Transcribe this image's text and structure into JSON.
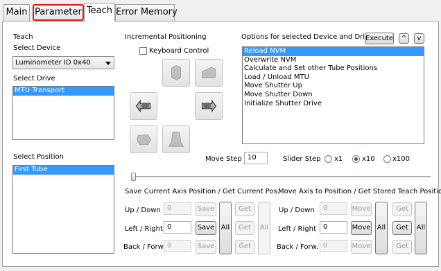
{
  "tabs": [
    {
      "label": "Main"
    },
    {
      "label": "Parameter"
    },
    {
      "label": "Teach"
    },
    {
      "label": "Error Memory"
    }
  ],
  "teach": {
    "title": "Teach",
    "select_device_label": "Select Device",
    "device_value": "Luminometer ID 0x40",
    "select_drive_label": "Select Drive",
    "drives": [
      "MTU Transport"
    ],
    "select_position_label": "Select Position",
    "positions": [
      "First Tube"
    ]
  },
  "incremental": {
    "title": "Incremental Positioning",
    "keyboard_control": "Keyboard Control",
    "keyboard_checked": false
  },
  "options": {
    "title": "Options for selected Device and Drive",
    "execute": "Execute",
    "up": "^",
    "down": "v",
    "items": [
      "Reload NVM",
      "Overwrite NVM",
      "Calculate and Set other Tube Positions",
      "Load / Unload MTU",
      "Move Shutter Up",
      "Move Shutter Down",
      "Initialize Shutter Drive"
    ],
    "selected_index": 0
  },
  "move_step": {
    "label": "Move Step",
    "value": "10"
  },
  "slider_step": {
    "label": "Slider Step",
    "options": [
      "x1",
      "x10",
      "x100"
    ],
    "selected_index": 1
  },
  "slider_level": 0,
  "save_section": {
    "title": "Save Current Axis Position / Get Current Pos.",
    "rows": [
      {
        "label": "Up / Down",
        "value": "0",
        "save": "Save",
        "get": "Get"
      },
      {
        "label": "Left / Right",
        "value": "0",
        "save": "Save",
        "get": "Get"
      },
      {
        "label": "Back / Forw.",
        "value": "0",
        "save": "Save",
        "get": "Get"
      }
    ],
    "all_save": "All",
    "all_get": "All"
  },
  "move_section": {
    "title": "Move Axis to Position / Get Stored Teach Position",
    "rows": [
      {
        "label": "Up / Down",
        "value": "0",
        "move": "Move",
        "get": "Get"
      },
      {
        "label": "Left / Right",
        "value": "0",
        "move": "Move",
        "get": "Get"
      },
      {
        "label": "Back / Forw.",
        "value": "0",
        "move": "Move",
        "get": "Get"
      }
    ],
    "all_move": "All",
    "all_get": "All"
  }
}
